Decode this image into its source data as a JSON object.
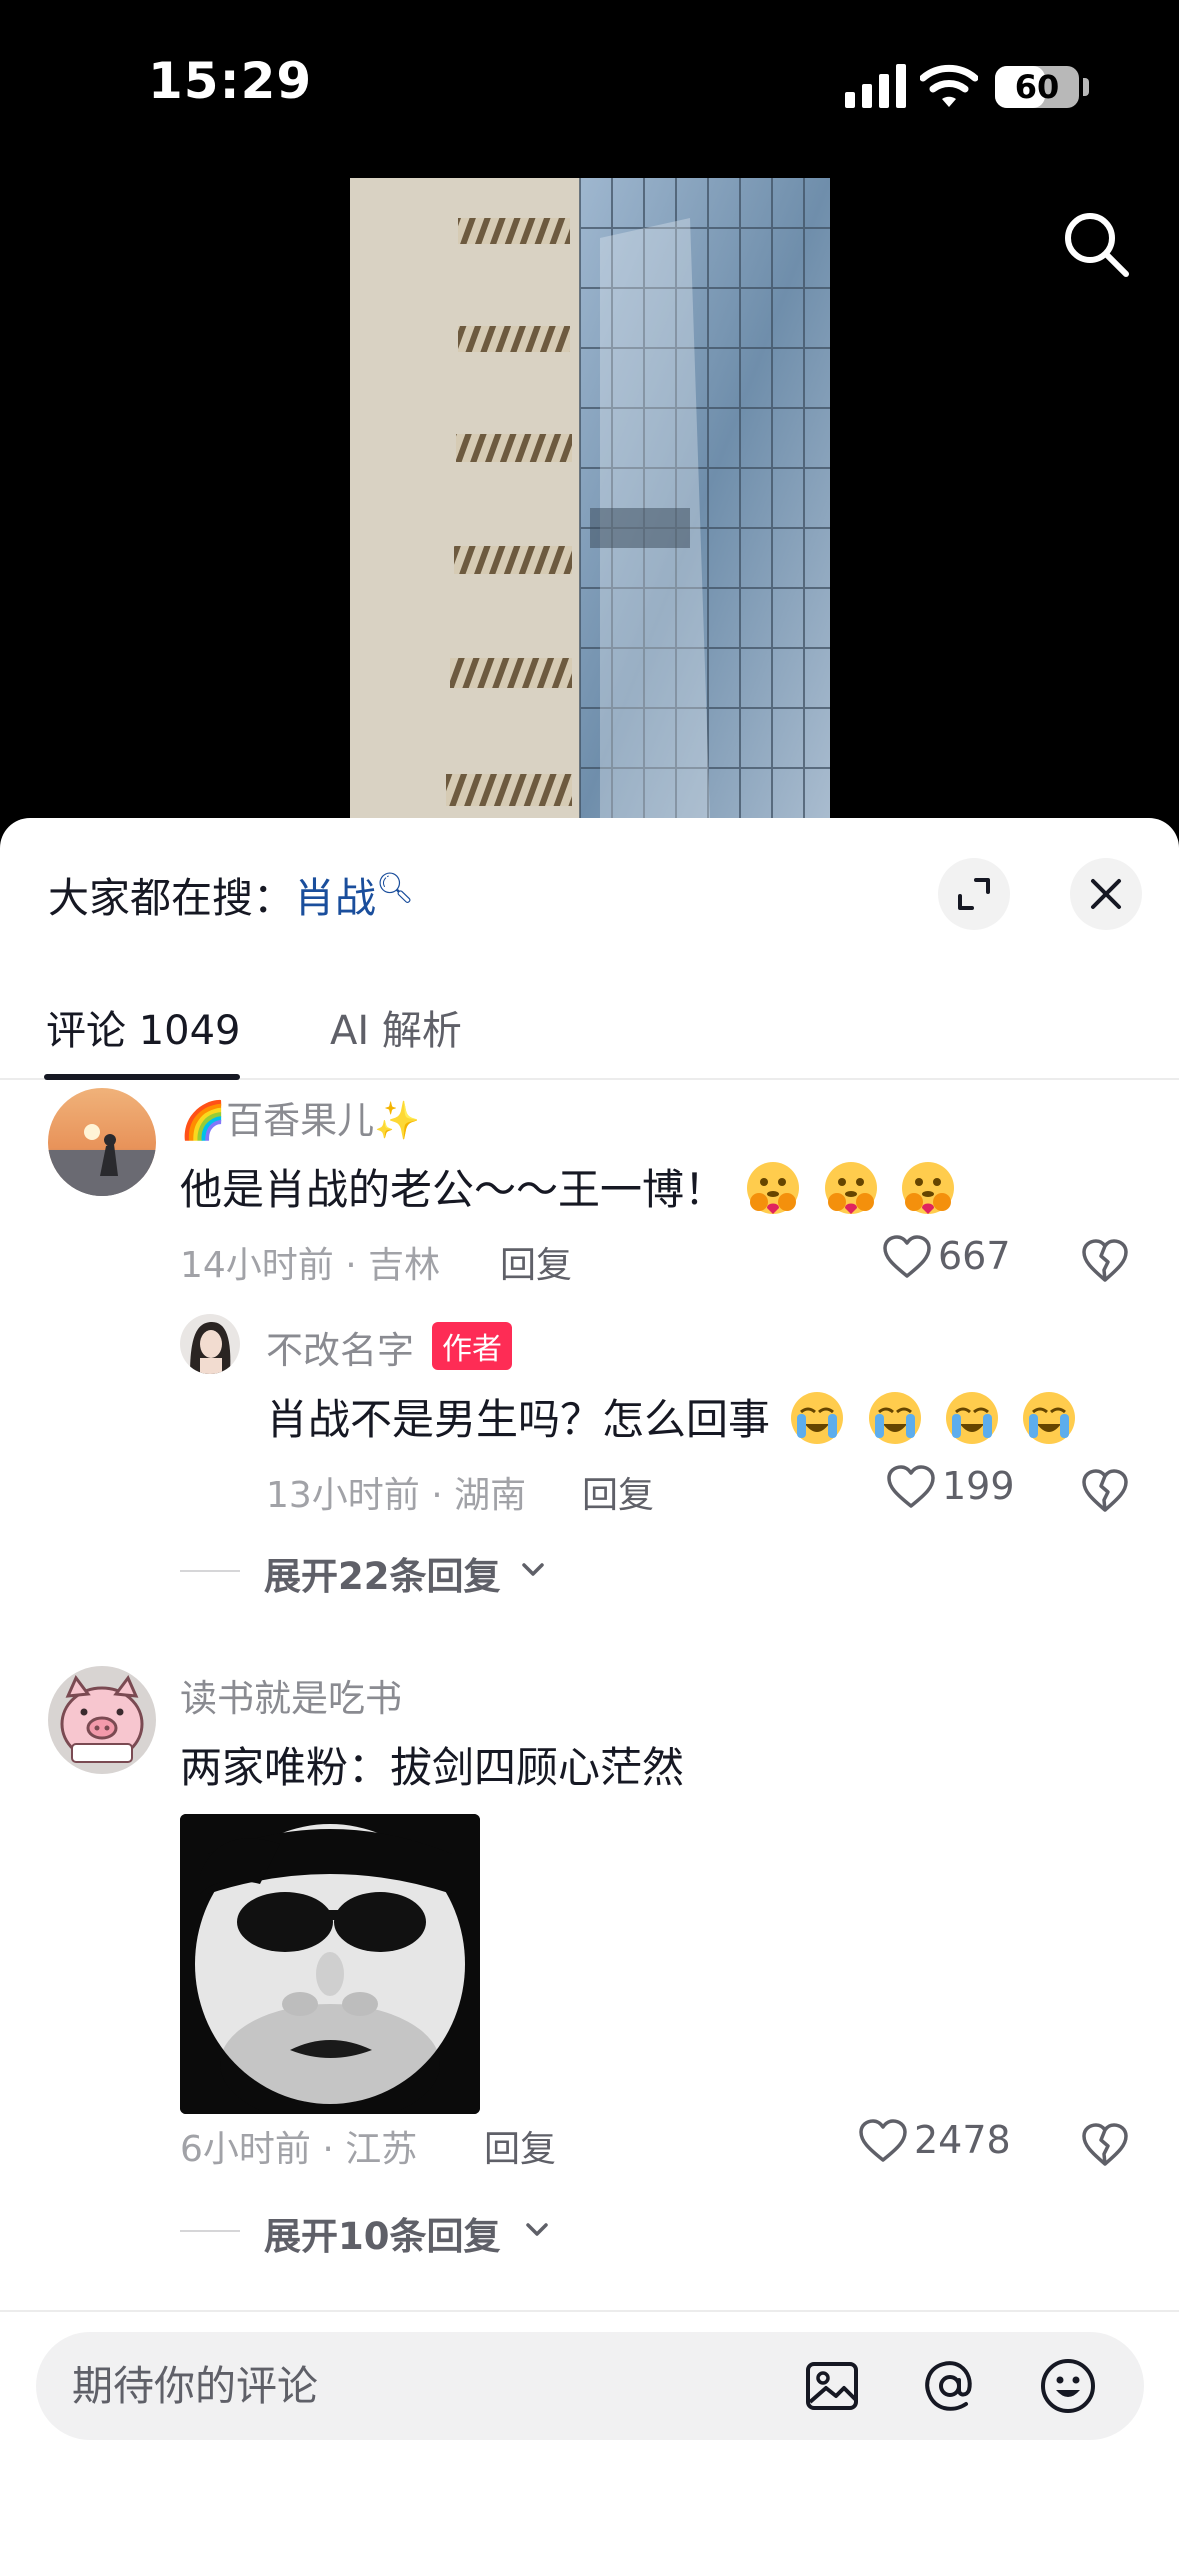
{
  "status_bar": {
    "time": "15:29",
    "battery": "60",
    "battery_level": 0.6
  },
  "hot_search": {
    "prefix": "大家都在搜：",
    "keyword": "肖战"
  },
  "tabs": [
    {
      "label": "评论 1049",
      "active": true
    },
    {
      "label": "AI 解析",
      "active": false
    }
  ],
  "comments": [
    {
      "username": "🌈百香果儿✨",
      "text": "他是肖战的老公～～王一博！",
      "meta": "14小时前 · 吉林",
      "reply_label": "回复",
      "likes": "667",
      "emoji": "hugging-face",
      "replies": [
        {
          "username": "不改名字",
          "badge": "作者",
          "text": "肖战不是男生吗？怎么回事",
          "meta": "13小时前 · 湖南",
          "reply_label": "回复",
          "likes": "199",
          "emoji": "crying-face"
        }
      ],
      "expand_label": "展开22条回复"
    },
    {
      "username": "读书就是吃书",
      "text": "两家唯粉：拔剑四顾心茫然",
      "meta": "6小时前 · 江苏",
      "reply_label": "回复",
      "likes": "2478",
      "expand_label": "展开10条回复"
    }
  ],
  "input": {
    "placeholder": "期待你的评论"
  },
  "icons": {
    "search": "search-icon",
    "expand": "expand-icon",
    "close": "close-icon",
    "like": "heart-icon",
    "dislike": "broken-heart-icon",
    "image": "image-icon",
    "mention": "at-icon",
    "emoji": "emoji-icon"
  },
  "colors": {
    "accent_link": "#1a4e9c",
    "author_badge": "#fe2c55"
  }
}
